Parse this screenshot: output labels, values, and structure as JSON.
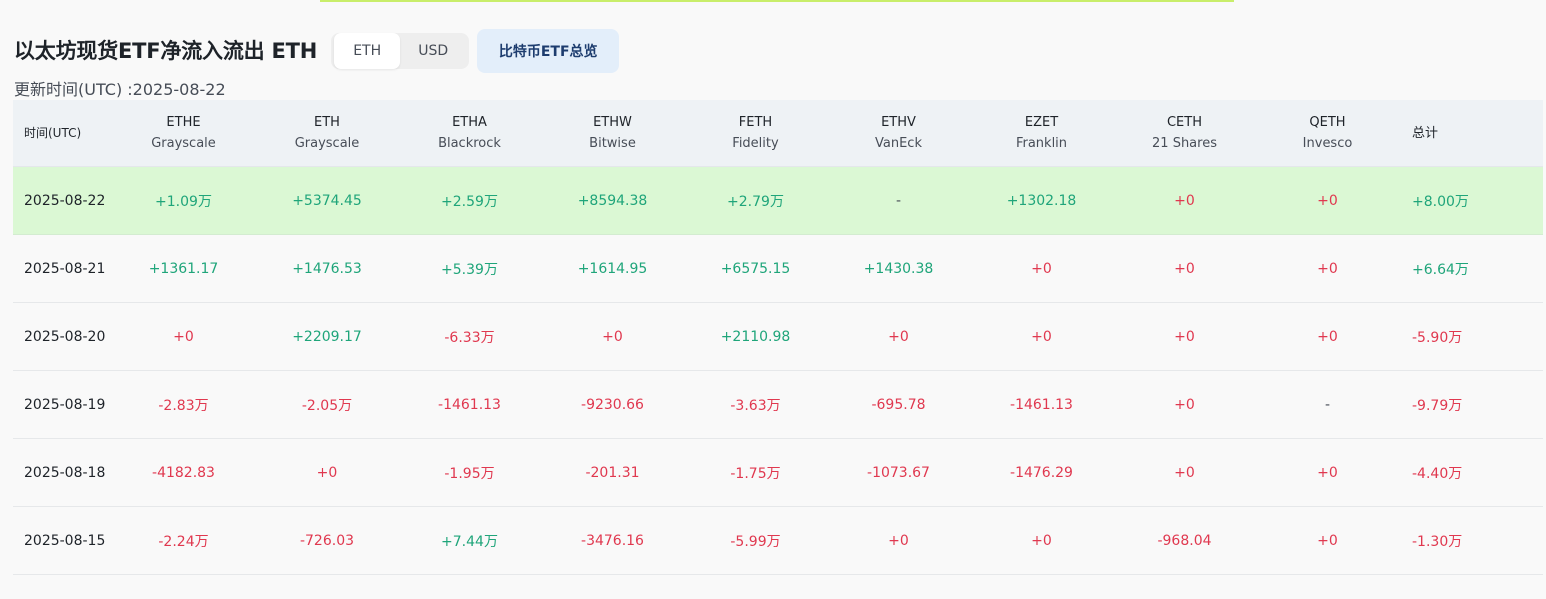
{
  "page": {
    "title": "以太坊现货ETF净流入流出 ETH",
    "update_time": "更新时间(UTC) :2025-08-22"
  },
  "unit_toggle": {
    "options": [
      "ETH",
      "USD"
    ],
    "selected": "ETH"
  },
  "btc_overview_button": "比特币ETF总览",
  "colors": {
    "positive": "#1fa57a",
    "negative": "#e0384f",
    "highlight_row": "#dbf8d4",
    "header_bg": "#eef2f5"
  },
  "table": {
    "date_header": "时间(UTC)",
    "total_header": "总计",
    "funds": [
      {
        "ticker": "ETHE",
        "issuer": "Grayscale"
      },
      {
        "ticker": "ETH",
        "issuer": "Grayscale"
      },
      {
        "ticker": "ETHA",
        "issuer": "Blackrock"
      },
      {
        "ticker": "ETHW",
        "issuer": "Bitwise"
      },
      {
        "ticker": "FETH",
        "issuer": "Fidelity"
      },
      {
        "ticker": "ETHV",
        "issuer": "VanEck"
      },
      {
        "ticker": "EZET",
        "issuer": "Franklin"
      },
      {
        "ticker": "CETH",
        "issuer": "21 Shares"
      },
      {
        "ticker": "QETH",
        "issuer": "Invesco"
      }
    ],
    "rows": [
      {
        "date": "2025-08-22",
        "values": [
          "+1.09万",
          "+5374.45",
          "+2.59万",
          "+8594.38",
          "+2.79万",
          "-",
          "+1302.18",
          "+0",
          "+0"
        ],
        "total": "+8.00万"
      },
      {
        "date": "2025-08-21",
        "values": [
          "+1361.17",
          "+1476.53",
          "+5.39万",
          "+1614.95",
          "+6575.15",
          "+1430.38",
          "+0",
          "+0",
          "+0"
        ],
        "total": "+6.64万"
      },
      {
        "date": "2025-08-20",
        "values": [
          "+0",
          "+2209.17",
          "-6.33万",
          "+0",
          "+2110.98",
          "+0",
          "+0",
          "+0",
          "+0"
        ],
        "total": "-5.90万"
      },
      {
        "date": "2025-08-19",
        "values": [
          "-2.83万",
          "-2.05万",
          "-1461.13",
          "-9230.66",
          "-3.63万",
          "-695.78",
          "-1461.13",
          "+0",
          "-"
        ],
        "total": "-9.79万"
      },
      {
        "date": "2025-08-18",
        "values": [
          "-4182.83",
          "+0",
          "-1.95万",
          "-201.31",
          "-1.75万",
          "-1073.67",
          "-1476.29",
          "+0",
          "+0"
        ],
        "total": "-4.40万"
      },
      {
        "date": "2025-08-15",
        "values": [
          "-2.24万",
          "-726.03",
          "+7.44万",
          "-3476.16",
          "-5.99万",
          "+0",
          "+0",
          "-968.04",
          "+0"
        ],
        "total": "-1.30万"
      }
    ]
  }
}
